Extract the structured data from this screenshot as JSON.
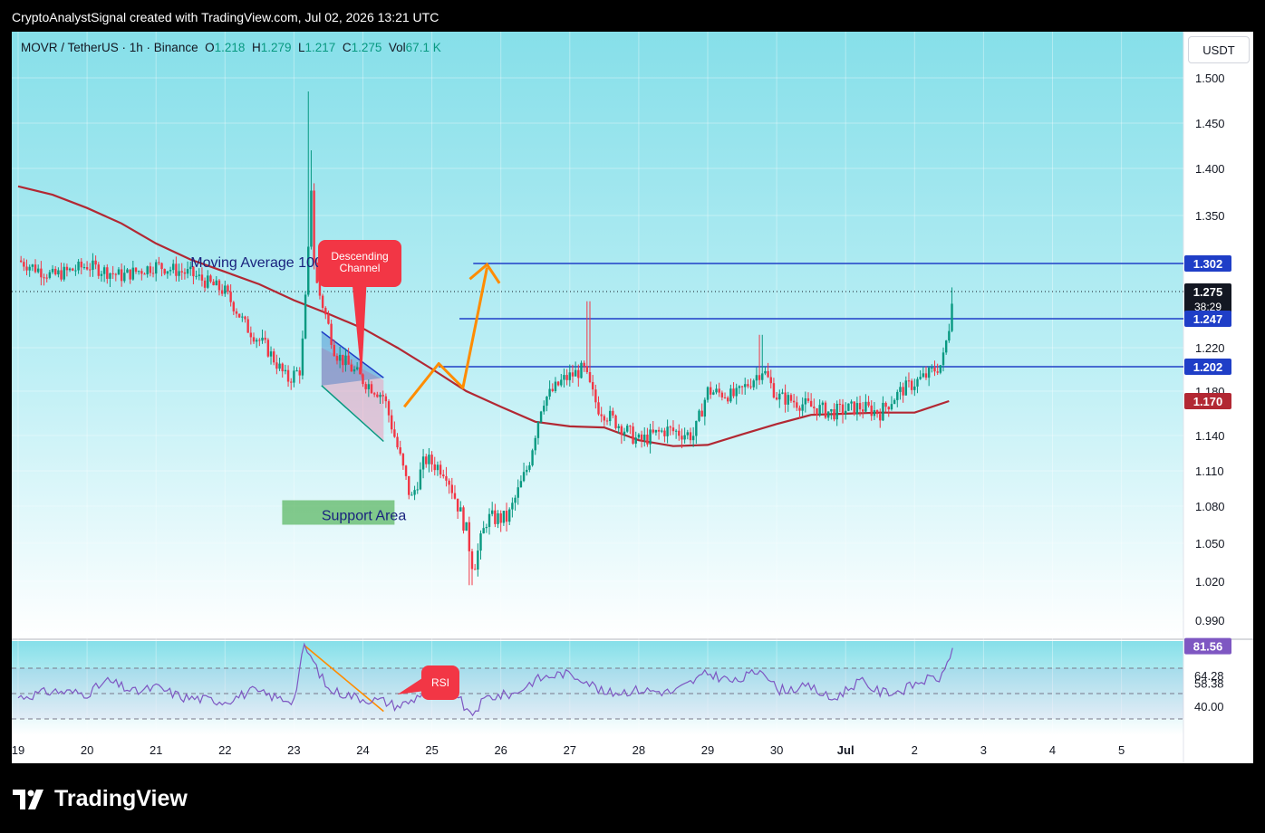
{
  "header": {
    "title": "CryptoAnalystSignal created with TradingView.com, Jul 02, 2026 13:21 UTC"
  },
  "legend": {
    "symbol": "MOVR / TetherUS · 1h · Binance",
    "open_label": "O",
    "open": "1.218",
    "high_label": "H",
    "high": "1.279",
    "low_label": "L",
    "low": "1.217",
    "close_label": "C",
    "close": "1.275",
    "vol_label": "Vol",
    "vol": "67.1 K"
  },
  "unit_button": "USDT",
  "brand": {
    "name": "TradingView",
    "logo_icon": "tradingview-logo-icon"
  },
  "colors": {
    "up": "#089981",
    "down": "#f23645",
    "ma": "#b22833",
    "level": "#1f3ec7",
    "rsi": "#7e57c2",
    "bg_top": "#86dfe9",
    "bg_bottom": "#ffffff",
    "arrow": "#ff8c00"
  },
  "chart_data": [
    {
      "type": "candlestick",
      "title": "MOVR / TetherUS · 1h · Binance",
      "x": [
        "19",
        "20",
        "21",
        "22",
        "23",
        "24",
        "25",
        "26",
        "27",
        "28",
        "29",
        "30",
        "Jul",
        "2",
        "3",
        "4",
        "5"
      ],
      "ylim": [
        0.97,
        1.53
      ],
      "y_ticks": [
        "1.500",
        "1.450",
        "1.400",
        "1.350",
        "1.220",
        "1.180",
        "1.140",
        "1.110",
        "1.080",
        "1.050",
        "1.020",
        "0.990"
      ],
      "series_close_path": [
        [
          19.0,
          1.305
        ],
        [
          19.5,
          1.29
        ],
        [
          20.0,
          1.3
        ],
        [
          20.5,
          1.29
        ],
        [
          21.0,
          1.3
        ],
        [
          21.5,
          1.292
        ],
        [
          22.0,
          1.275
        ],
        [
          22.3,
          1.24
        ],
        [
          22.6,
          1.22
        ],
        [
          22.9,
          1.19
        ],
        [
          23.1,
          1.2
        ],
        [
          23.2,
          1.3
        ],
        [
          23.25,
          1.38
        ],
        [
          23.3,
          1.29
        ],
        [
          23.6,
          1.215
        ],
        [
          24.0,
          1.19
        ],
        [
          24.3,
          1.175
        ],
        [
          24.5,
          1.13
        ],
        [
          24.7,
          1.085
        ],
        [
          24.9,
          1.12
        ],
        [
          25.2,
          1.11
        ],
        [
          25.5,
          1.06
        ],
        [
          25.6,
          1.03
        ],
        [
          25.8,
          1.07
        ],
        [
          26.1,
          1.07
        ],
        [
          26.4,
          1.115
        ],
        [
          26.6,
          1.17
        ],
        [
          26.9,
          1.19
        ],
        [
          27.2,
          1.2
        ],
        [
          27.4,
          1.165
        ],
        [
          27.7,
          1.15
        ],
        [
          28.0,
          1.135
        ],
        [
          28.4,
          1.145
        ],
        [
          28.8,
          1.14
        ],
        [
          29.0,
          1.18
        ],
        [
          29.4,
          1.175
        ],
        [
          29.8,
          1.2
        ],
        [
          30.0,
          1.175
        ],
        [
          30.5,
          1.165
        ],
        [
          30.8,
          1.16
        ],
        [
          31.2,
          1.165
        ],
        [
          31.5,
          1.16
        ],
        [
          31.8,
          1.18
        ],
        [
          32.2,
          1.195
        ],
        [
          32.4,
          1.205
        ],
        [
          32.5,
          1.24
        ],
        [
          32.55,
          1.275
        ]
      ],
      "ma_label": "Moving Average 100",
      "ma_path": [
        [
          19.0,
          1.381
        ],
        [
          19.5,
          1.372
        ],
        [
          20.0,
          1.358
        ],
        [
          20.5,
          1.342
        ],
        [
          21.0,
          1.322
        ],
        [
          21.5,
          1.306
        ],
        [
          22.0,
          1.294
        ],
        [
          22.5,
          1.282
        ],
        [
          23.0,
          1.266
        ],
        [
          23.5,
          1.252
        ],
        [
          24.0,
          1.238
        ],
        [
          24.5,
          1.22
        ],
        [
          25.0,
          1.2
        ],
        [
          25.5,
          1.18
        ],
        [
          26.0,
          1.165
        ],
        [
          26.5,
          1.152
        ],
        [
          27.0,
          1.148
        ],
        [
          27.5,
          1.147
        ],
        [
          28.0,
          1.136
        ],
        [
          28.5,
          1.131
        ],
        [
          29.0,
          1.132
        ],
        [
          29.5,
          1.141
        ],
        [
          30.0,
          1.15
        ],
        [
          30.5,
          1.158
        ],
        [
          31.0,
          1.159
        ],
        [
          31.5,
          1.16
        ],
        [
          32.0,
          1.16
        ],
        [
          32.5,
          1.17
        ]
      ],
      "levels": [
        1.302,
        1.247,
        1.202
      ],
      "axis_tags": [
        {
          "value": "1.302",
          "kind": "level"
        },
        {
          "value": "1.275",
          "kind": "last",
          "sub": "38:29"
        },
        {
          "value": "1.247",
          "kind": "level"
        },
        {
          "value": "1.202",
          "kind": "level"
        },
        {
          "value": "1.170",
          "kind": "ma"
        }
      ],
      "annotations": {
        "descending_channel": "Descending\nChannel",
        "support_area": "Support Area",
        "moving_average": "Moving Average 100"
      }
    },
    {
      "type": "line",
      "title": "RSI",
      "ylim": [
        30,
        90
      ],
      "guide_lines": [
        70,
        50,
        30
      ],
      "y_ticks": [
        "81.56",
        "64.28",
        "58.38",
        "40.00"
      ],
      "rsi_path": [
        [
          19.0,
          47
        ],
        [
          19.5,
          52
        ],
        [
          20.0,
          50
        ],
        [
          20.3,
          60
        ],
        [
          20.7,
          51
        ],
        [
          21.0,
          55
        ],
        [
          21.4,
          47
        ],
        [
          21.8,
          45
        ],
        [
          22.0,
          44
        ],
        [
          22.4,
          52
        ],
        [
          22.8,
          46
        ],
        [
          23.0,
          45
        ],
        [
          23.15,
          88
        ],
        [
          23.5,
          53
        ],
        [
          24.0,
          46
        ],
        [
          24.3,
          44
        ],
        [
          24.5,
          40
        ],
        [
          24.7,
          44
        ],
        [
          25.0,
          57
        ],
        [
          25.3,
          55
        ],
        [
          25.55,
          32
        ],
        [
          25.8,
          47
        ],
        [
          26.2,
          50
        ],
        [
          26.5,
          61
        ],
        [
          26.9,
          66
        ],
        [
          27.2,
          62
        ],
        [
          27.5,
          50
        ],
        [
          28.0,
          53
        ],
        [
          28.5,
          51
        ],
        [
          29.0,
          66
        ],
        [
          29.4,
          59
        ],
        [
          29.8,
          70
        ],
        [
          30.0,
          53
        ],
        [
          30.5,
          55
        ],
        [
          30.8,
          45
        ],
        [
          31.2,
          60
        ],
        [
          31.5,
          51
        ],
        [
          31.8,
          52
        ],
        [
          32.1,
          60
        ],
        [
          32.4,
          63
        ],
        [
          32.55,
          86
        ]
      ],
      "rsi_value": "81.56"
    }
  ]
}
